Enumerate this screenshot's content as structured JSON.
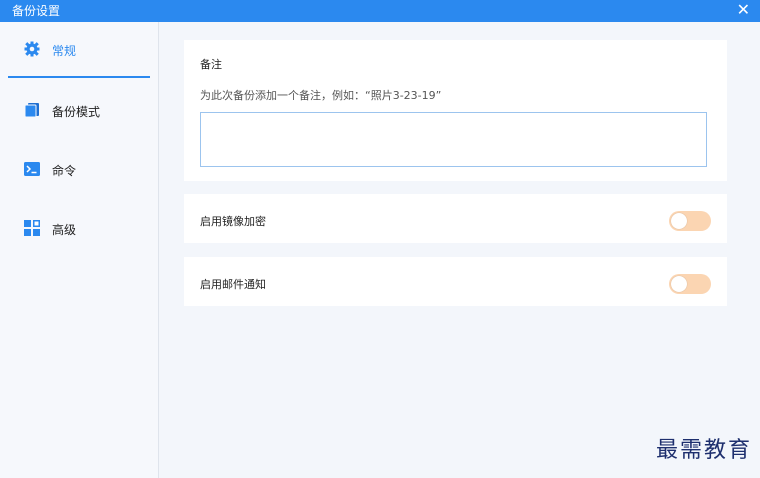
{
  "window": {
    "title": "备份设置",
    "close_glyph": "✕"
  },
  "sidebar": {
    "items": [
      {
        "label": "常规",
        "icon": "gear-icon",
        "active": true
      },
      {
        "label": "备份模式",
        "icon": "backup-mode-icon",
        "active": false
      },
      {
        "label": "命令",
        "icon": "terminal-icon",
        "active": false
      },
      {
        "label": "高级",
        "icon": "grid-icon",
        "active": false
      }
    ]
  },
  "main": {
    "note": {
      "heading": "备注",
      "description": "为此次备份添加一个备注，例如：“照片3-23-19”",
      "value": ""
    },
    "mirror_encryption": {
      "label": "启用镜像加密",
      "enabled": false
    },
    "email_notification": {
      "label": "启用邮件通知",
      "enabled": false
    }
  },
  "watermark": "最需教育",
  "colors": {
    "accent": "#2b89ef",
    "toggle_off": "#fbd5b2",
    "background": "#f3f6fb"
  }
}
